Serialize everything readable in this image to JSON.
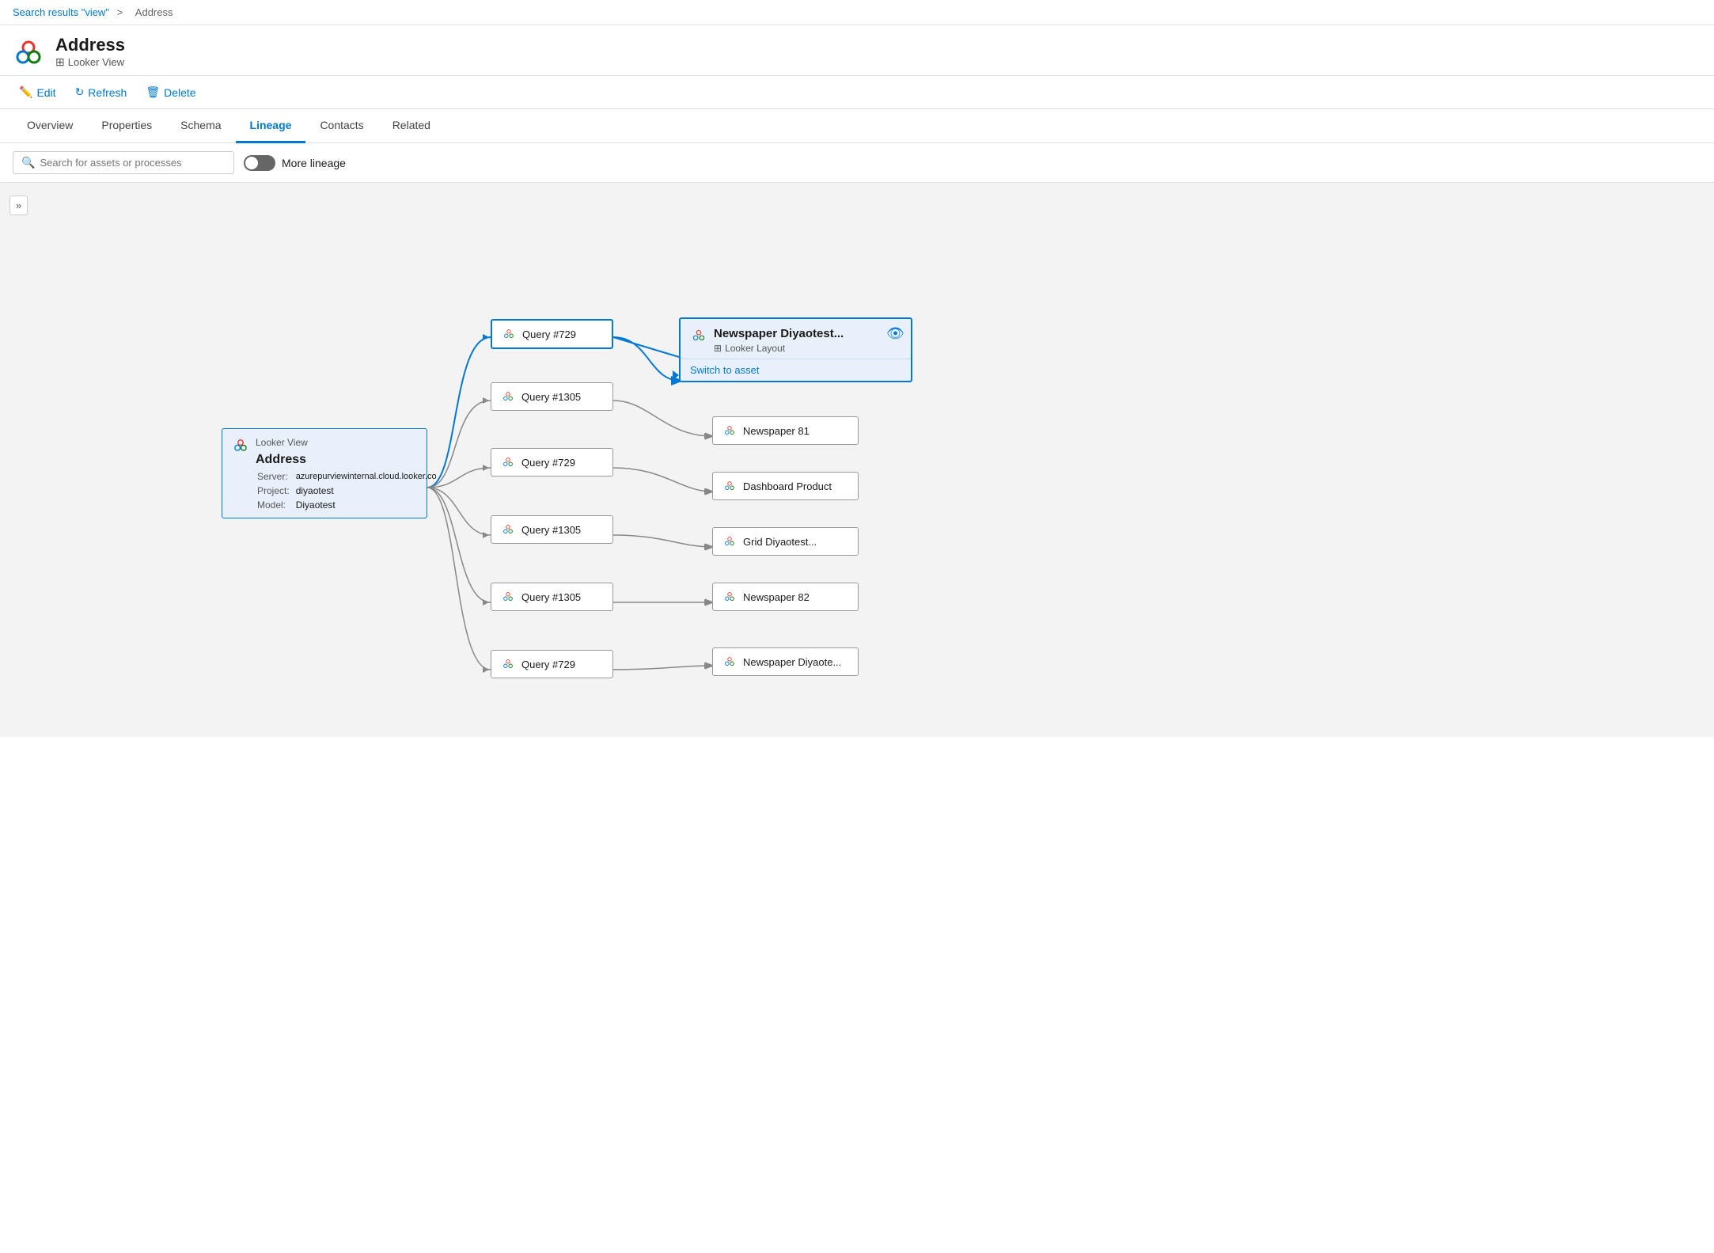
{
  "breadcrumb": {
    "link_text": "Search results \"view\"",
    "separator": ">",
    "current": "Address"
  },
  "header": {
    "title": "Address",
    "subtitle": "Looker View",
    "subtitle_icon": "table-icon"
  },
  "toolbar": {
    "edit_label": "Edit",
    "refresh_label": "Refresh",
    "delete_label": "Delete"
  },
  "tabs": [
    {
      "label": "Overview",
      "active": false
    },
    {
      "label": "Properties",
      "active": false
    },
    {
      "label": "Schema",
      "active": false
    },
    {
      "label": "Lineage",
      "active": true
    },
    {
      "label": "Contacts",
      "active": false
    },
    {
      "label": "Related",
      "active": false
    }
  ],
  "lineage_controls": {
    "search_placeholder": "Search for assets or processes",
    "more_lineage_label": "More lineage",
    "toggle_on": false
  },
  "expand_button": "»",
  "source_node": {
    "type_label": "Looker View",
    "title": "Address",
    "server_label": "Server:",
    "server_value": "azurepurviewinternal.cloud.looker.co",
    "project_label": "Project:",
    "project_value": "diyaotest",
    "model_label": "Model:",
    "model_value": "Diyaotest"
  },
  "query_nodes": [
    {
      "id": "q1",
      "label": "Query #729"
    },
    {
      "id": "q2",
      "label": "Query #1305"
    },
    {
      "id": "q3",
      "label": "Query #729"
    },
    {
      "id": "q4",
      "label": "Query #1305"
    },
    {
      "id": "q5",
      "label": "Query #1305"
    },
    {
      "id": "q6",
      "label": "Query #729"
    }
  ],
  "output_nodes": [
    {
      "id": "o0",
      "label": "Newspaper Diyaotest...",
      "type": "Looker Layout",
      "highlighted": true,
      "switch_to_asset": "Switch to asset"
    },
    {
      "id": "o1",
      "label": "Newspaper 81",
      "highlighted": false
    },
    {
      "id": "o2",
      "label": "Dashboard Product",
      "highlighted": false
    },
    {
      "id": "o3",
      "label": "Grid Diyaotest...",
      "highlighted": false
    },
    {
      "id": "o4",
      "label": "Newspaper 82",
      "highlighted": false
    },
    {
      "id": "o5",
      "label": "Newspaper Diyaote...",
      "highlighted": false
    }
  ]
}
